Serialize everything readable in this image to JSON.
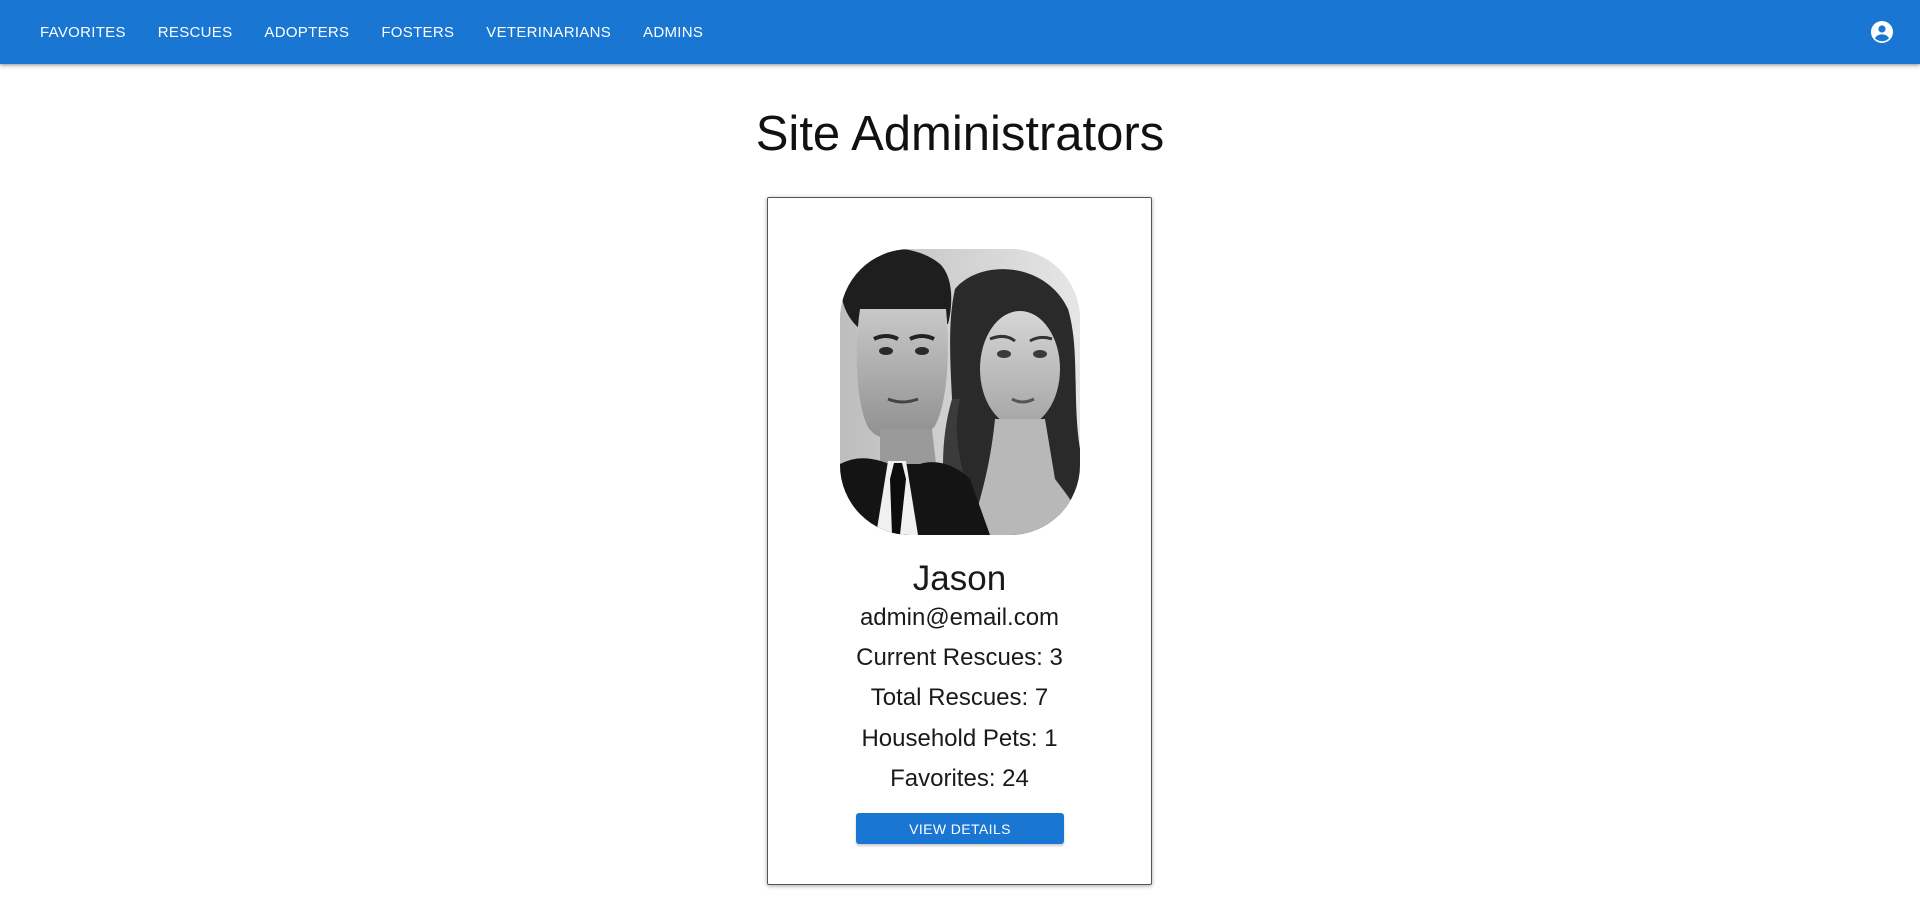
{
  "header": {
    "nav": [
      {
        "label": "FAVORITES"
      },
      {
        "label": "RESCUES"
      },
      {
        "label": "ADOPTERS"
      },
      {
        "label": "FOSTERS"
      },
      {
        "label": "VETERINARIANS"
      },
      {
        "label": "ADMINS"
      }
    ],
    "account_icon": "account-circle-icon",
    "background_color": "#1976d2"
  },
  "page": {
    "title": "Site Administrators"
  },
  "admins": [
    {
      "name": "Jason",
      "email": "admin@email.com",
      "stats": [
        "Current Rescues: 3",
        "Total Rescues: 7",
        "Household Pets: 1",
        "Favorites: 24"
      ],
      "button_label": "VIEW DETAILS",
      "photo": "black-and-white portrait of a man and a woman"
    }
  ],
  "colors": {
    "accent": "#1976d2"
  }
}
